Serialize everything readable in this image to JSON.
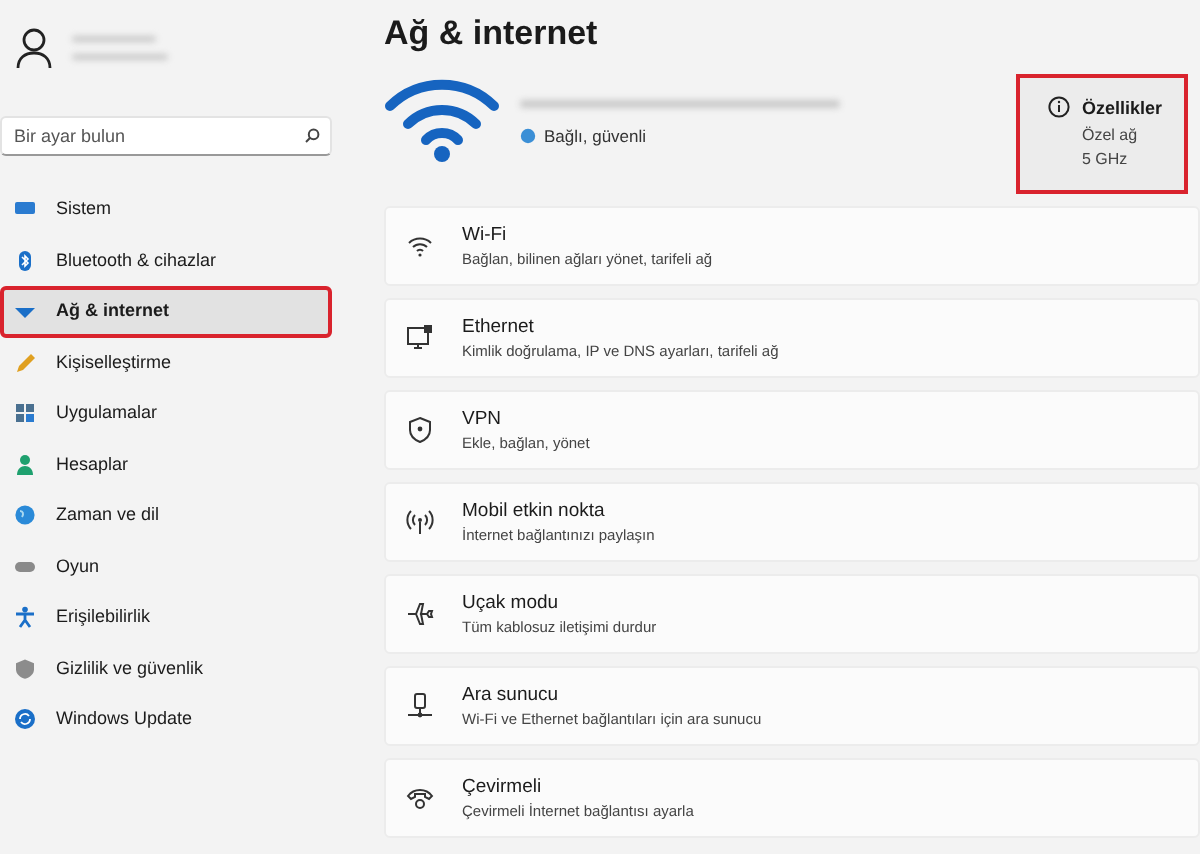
{
  "sidebar": {
    "search": {
      "placeholder": "Bir ayar bulun"
    },
    "items": [
      {
        "label": "Sistem",
        "selected": false,
        "highlighted": false
      },
      {
        "label": "Bluetooth & cihazlar",
        "selected": false,
        "highlighted": false
      },
      {
        "label": "Ağ & internet",
        "selected": true,
        "highlighted": true
      },
      {
        "label": "Kişiselleştirme",
        "selected": false,
        "highlighted": false
      },
      {
        "label": "Uygulamalar",
        "selected": false,
        "highlighted": false
      },
      {
        "label": "Hesaplar",
        "selected": false,
        "highlighted": false
      },
      {
        "label": "Zaman ve dil",
        "selected": false,
        "highlighted": false
      },
      {
        "label": "Oyun",
        "selected": false,
        "highlighted": false
      },
      {
        "label": "Erişilebilirlik",
        "selected": false,
        "highlighted": false
      },
      {
        "label": "Gizlilik ve güvenlik",
        "selected": false,
        "highlighted": false
      },
      {
        "label": "Windows Update",
        "selected": false,
        "highlighted": false
      }
    ]
  },
  "page_title": "Ağ & internet",
  "connection": {
    "status": "Bağlı, güvenli",
    "properties": {
      "title": "Özellikler",
      "lines": [
        "Özel ağ",
        "5 GHz"
      ],
      "highlighted": true
    }
  },
  "settings": [
    {
      "title": "Wi-Fi",
      "subtitle": "Bağlan, bilinen ağları yönet, tarifeli ağ"
    },
    {
      "title": "Ethernet",
      "subtitle": "Kimlik doğrulama, IP ve DNS ayarları, tarifeli ağ"
    },
    {
      "title": "VPN",
      "subtitle": "Ekle, bağlan, yönet"
    },
    {
      "title": "Mobil etkin nokta",
      "subtitle": "İnternet bağlantınızı paylaşın"
    },
    {
      "title": "Uçak modu",
      "subtitle": "Tüm kablosuz iletişimi durdur"
    },
    {
      "title": "Ara sunucu",
      "subtitle": "Wi-Fi ve Ethernet bağlantıları için ara sunucu"
    },
    {
      "title": "Çevirmeli",
      "subtitle": "Çevirmeli İnternet bağlantısı ayarla"
    }
  ]
}
